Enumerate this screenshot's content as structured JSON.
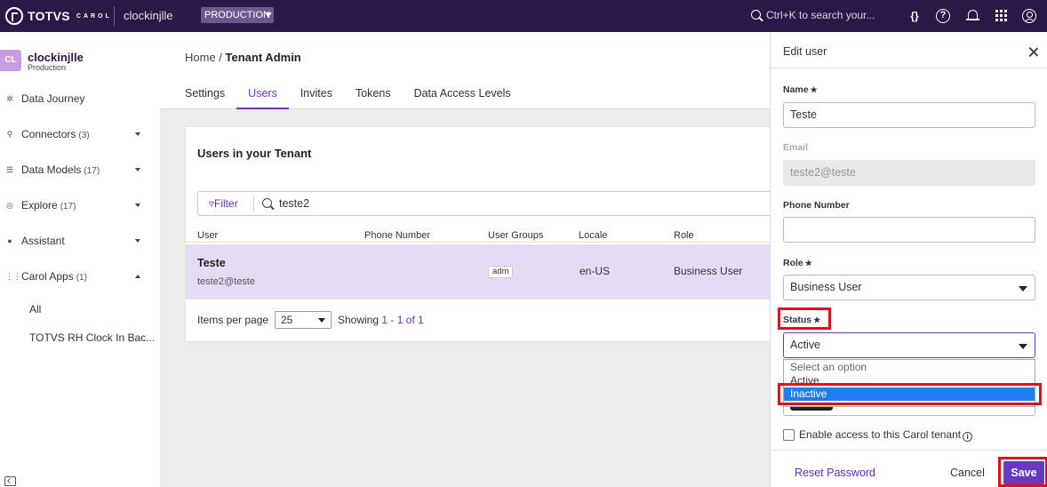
{
  "topbar": {
    "brand": "TOTVS",
    "brand_sub": "CAROL",
    "tenant": "clockinjlle",
    "environment": "PRODUCTION",
    "search_placeholder": "Ctrl+K to search your...",
    "braces_icon": "{}",
    "help_icon": "?"
  },
  "sidebar": {
    "tenant_badge": "CL",
    "tenant_name": "clockinjlle",
    "tenant_env": "Production",
    "items": [
      {
        "label": "Data Journey",
        "count": "",
        "icon": "journey-icon"
      },
      {
        "label": "Connectors",
        "count": "(3)",
        "icon": "connector-icon"
      },
      {
        "label": "Data Models",
        "count": "(17)",
        "icon": "data-model-icon"
      },
      {
        "label": "Explore",
        "count": "(17)",
        "icon": "explore-icon"
      },
      {
        "label": "Assistant",
        "count": "",
        "icon": "assistant-icon"
      },
      {
        "label": "Carol Apps",
        "count": "(1)",
        "icon": "apps-icon"
      }
    ],
    "sub_items": [
      "All",
      "TOTVS RH Clock In Bac..."
    ]
  },
  "breadcrumb": {
    "home": "Home",
    "separator": " / ",
    "current": "Tenant Admin"
  },
  "tabs": [
    "Settings",
    "Users",
    "Invites",
    "Tokens",
    "Data Access Levels"
  ],
  "users_card": {
    "title": "Users in your Tenant",
    "filter_label": "Filter",
    "filter_icon": "▿",
    "search_value": "teste2",
    "columns": [
      "User",
      "Phone Number",
      "User Groups",
      "Locale",
      "Role"
    ],
    "rows": [
      {
        "name": "Teste",
        "email": "teste2@teste",
        "phone": "",
        "group": "adm",
        "locale": "en-US",
        "role": "Business User"
      }
    ],
    "items_per_page_label": "Items per page",
    "items_per_page": "25",
    "showing_prefix": "Showing",
    "showing_from": "1",
    "showing_sep": " - ",
    "showing_to": "1",
    "showing_of": "of",
    "showing_total": "1"
  },
  "edit_panel": {
    "title": "Edit user",
    "name_label": "Name",
    "name_value": "Teste",
    "email_label": "Email",
    "email_value": "teste2@teste",
    "phone_label": "Phone Number",
    "phone_value": "",
    "role_label": "Role",
    "role_value": "Business User",
    "status_label": "Status",
    "status_value": "Active",
    "required_mark": "★",
    "status_options": [
      "Select an option",
      "Active",
      "Inactive"
    ],
    "status_highlighted_option": "Inactive",
    "enable_access_label": "Enable access to this Carol tenant",
    "info_icon": "i",
    "reset_password": "Reset Password",
    "cancel": "Cancel",
    "save": "Save"
  },
  "colors": {
    "topbar": "#2a1846",
    "accent": "#6b38c2",
    "selected_row": "#e4dbf4",
    "annotation_red": "#e0101f",
    "dropdown_selected": "#1e7ff0"
  }
}
